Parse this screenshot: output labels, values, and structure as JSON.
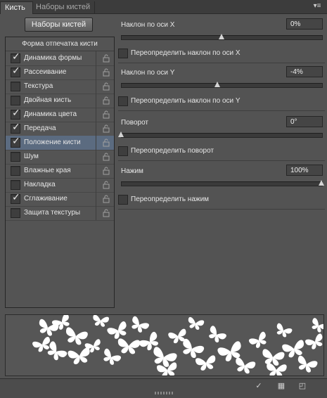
{
  "tabs": {
    "active": "Кисть",
    "inactive": "Наборы кистей"
  },
  "presets_button": "Наборы кистей",
  "left_panel": {
    "header": "Форма отпечатка кисти",
    "items": [
      {
        "label": "Динамика формы",
        "checked": true,
        "locked": true
      },
      {
        "label": "Рассеивание",
        "checked": true,
        "locked": true
      },
      {
        "label": "Текстура",
        "checked": false,
        "locked": true
      },
      {
        "label": "Двойная кисть",
        "checked": false,
        "locked": true
      },
      {
        "label": "Динамика цвета",
        "checked": true,
        "locked": true
      },
      {
        "label": "Передача",
        "checked": true,
        "locked": true
      },
      {
        "label": "Положение кисти",
        "checked": true,
        "locked": true,
        "selected": true
      },
      {
        "label": "Шум",
        "checked": false,
        "locked": true
      },
      {
        "label": "Влажные края",
        "checked": false,
        "locked": true
      },
      {
        "label": "Накладка",
        "checked": false,
        "locked": true
      },
      {
        "label": "Сглаживание",
        "checked": true,
        "locked": true
      },
      {
        "label": "Защита текстуры",
        "checked": false,
        "locked": true
      }
    ]
  },
  "controls": {
    "tilt_x": {
      "label": "Наклон по оси X",
      "value": "0%",
      "slider": 0.5,
      "override_label": "Переопределить наклон по оси X",
      "override_checked": false
    },
    "tilt_y": {
      "label": "Наклон по оси Y",
      "value": "-4%",
      "slider": 0.48,
      "override_label": "Переопределить наклон по оси Y",
      "override_checked": false
    },
    "rotation": {
      "label": "Поворот",
      "value": "0°",
      "slider": 0.0,
      "override_label": "Переопределить поворот",
      "override_checked": false
    },
    "pressure": {
      "label": "Нажим",
      "value": "100%",
      "slider": 1.0,
      "override_label": "Переопределить нажим",
      "override_checked": false
    }
  },
  "bottom_icons": [
    "brush-toggle-icon",
    "grid-icon",
    "new-preset-icon"
  ],
  "colors": {
    "panel": "#535353",
    "selected_row": "#5b6b80"
  }
}
